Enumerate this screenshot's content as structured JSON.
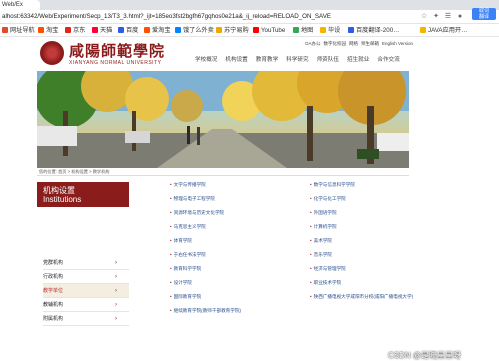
{
  "browser": {
    "tab_title": "Web/Ex",
    "url": "alhost:63342/Web/Experiment/Secp_13/T3_3.html?_ijt=185eo3fst2bgfh67gqhos0e21a&_ij_reload=RELOAD_ON_SAVE",
    "ext_label_1": "取词",
    "ext_label_2": "翻译"
  },
  "bookmarks": [
    {
      "label": "网址导航",
      "color": "#e34a2b"
    },
    {
      "label": "淘宝",
      "color": "#ff5000"
    },
    {
      "label": "京东",
      "color": "#e1251b"
    },
    {
      "label": "天猫",
      "color": "#ff0036"
    },
    {
      "label": "百度",
      "color": "#2f5bea"
    },
    {
      "label": "爱淘宝",
      "color": "#ff5000"
    },
    {
      "label": "饿了么外卖",
      "color": "#0085ff"
    },
    {
      "label": "苏宁易购",
      "color": "#f2a600"
    },
    {
      "label": "YouTube",
      "color": "#ff0000"
    },
    {
      "label": "地图",
      "color": "#34a853"
    },
    {
      "label": "毕设",
      "color": "#f4b400"
    },
    {
      "label": "百度翻译-200…",
      "color": "#2f5bea"
    },
    {
      "label": "JAVA应用开…",
      "color": "#f4b400"
    }
  ],
  "header": {
    "logo_cn": "咸陽師範學院",
    "logo_en": "XIANYANG NORMAL UNIVERSITY",
    "top_links": [
      "OA办公",
      "数字化校园",
      "网络",
      "师生邮箱",
      "English Version"
    ],
    "nav": [
      "学校概况",
      "机构设置",
      "教育教学",
      "科学研究",
      "师资队伍",
      "招生就业",
      "合作交流"
    ]
  },
  "breadcrumb": "您的位置: 首页 > 机构设置 > 教学机构",
  "sidebar": {
    "title": "机构设置",
    "subtitle": "Institutions",
    "items": [
      {
        "label": "党群机构",
        "active": false
      },
      {
        "label": "行政机构",
        "active": false
      },
      {
        "label": "教学单位",
        "active": true
      },
      {
        "label": "教辅机构",
        "active": false
      },
      {
        "label": "附属机构",
        "active": false
      }
    ]
  },
  "units_left": [
    "文学与传播学院",
    "物理与电子工程学院",
    "资源环境与历史文化学院",
    "马克思主义学院",
    "体育学院",
    "于右任书法学院",
    "教育科学学院",
    "设计学院",
    "国际教育学院",
    "继续教育学院(教师干部教育学院)"
  ],
  "units_right": [
    "数学与信息科学学院",
    "化学与化工学院",
    "外国语学院",
    "计算机学院",
    "美术学院",
    "音乐学院",
    "经济与管理学院",
    "职业技术学院",
    "陕西广播电视大学咸阳市分校(咸阳广播电视大学)",
    ""
  ],
  "watermark": "CSDN @是晓星星呀",
  "colors": {
    "brand": "#8b1c1c",
    "link": "#2a4e8c",
    "active_bg": "#f3eee0"
  }
}
